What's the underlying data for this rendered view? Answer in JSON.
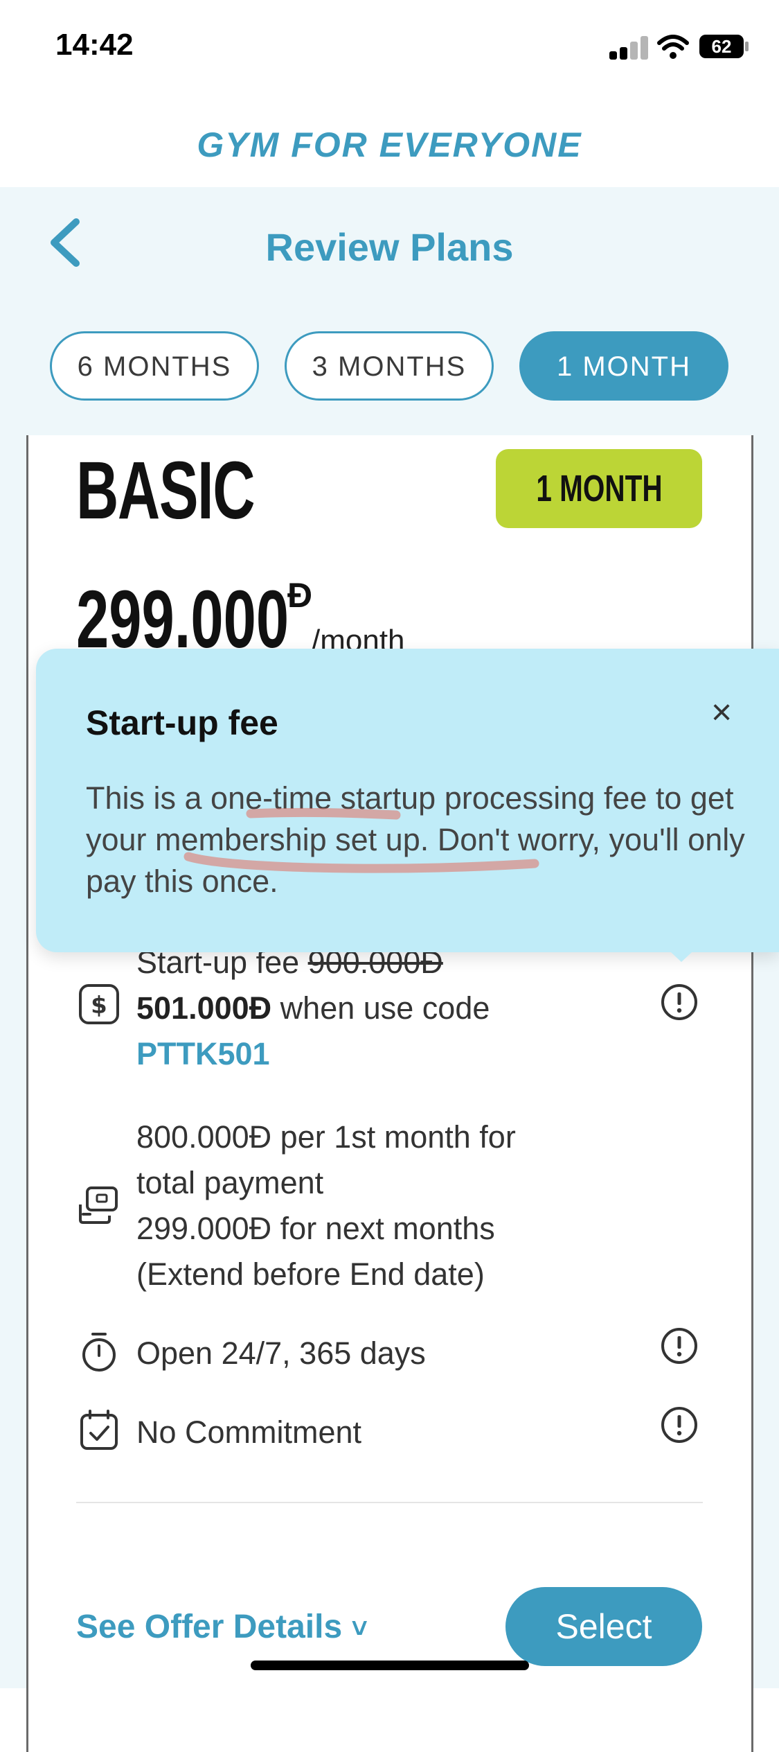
{
  "status_bar": {
    "time": "14:42",
    "battery": "62"
  },
  "brand": {
    "title": "GYM FOR EVERYONE"
  },
  "header": {
    "title": "Review Plans"
  },
  "tabs": [
    {
      "label": "6 MONTHS",
      "active": false
    },
    {
      "label": "3 MONTHS",
      "active": false
    },
    {
      "label": "1 MONTH",
      "active": true
    }
  ],
  "plan": {
    "name": "BASIC",
    "badge": "1 MONTH",
    "price": "299.000",
    "currency": "Đ",
    "unit": "/month"
  },
  "features": {
    "startup_prefix": "Start-up fee ",
    "startup_old": "900.000Đ",
    "startup_new": "501.000Đ",
    "startup_mid": " when use code",
    "startup_code": "PTTK501",
    "payment_lines": [
      "800.000Đ per 1st month for",
      "total payment",
      "299.000Đ for next months",
      "(Extend before End date)"
    ],
    "open_hours": "Open 24/7, 365 days",
    "commitment": "No Commitment"
  },
  "footer": {
    "offer_link": "See Offer Details",
    "offer_chevron": "˅",
    "select_label": "Select"
  },
  "tooltip": {
    "title": "Start-up fee",
    "close": "×",
    "body": "This is a one-time startup processing fee to get your membership set up. Don't worry, you'll only pay this once."
  },
  "colors": {
    "brand": "#3d9bbf",
    "badge": "#bcd536",
    "tooltip_bg": "#c0ecf8",
    "page_bg": "#eef7fa",
    "annotation": "#e07a6e"
  },
  "icons": [
    "back-chevron-icon",
    "dollar-icon",
    "payment-card-icon",
    "stopwatch-icon",
    "calendar-check-icon",
    "info-icon",
    "close-icon",
    "chevron-down-icon",
    "signal-icon",
    "wifi-icon",
    "battery-icon"
  ]
}
